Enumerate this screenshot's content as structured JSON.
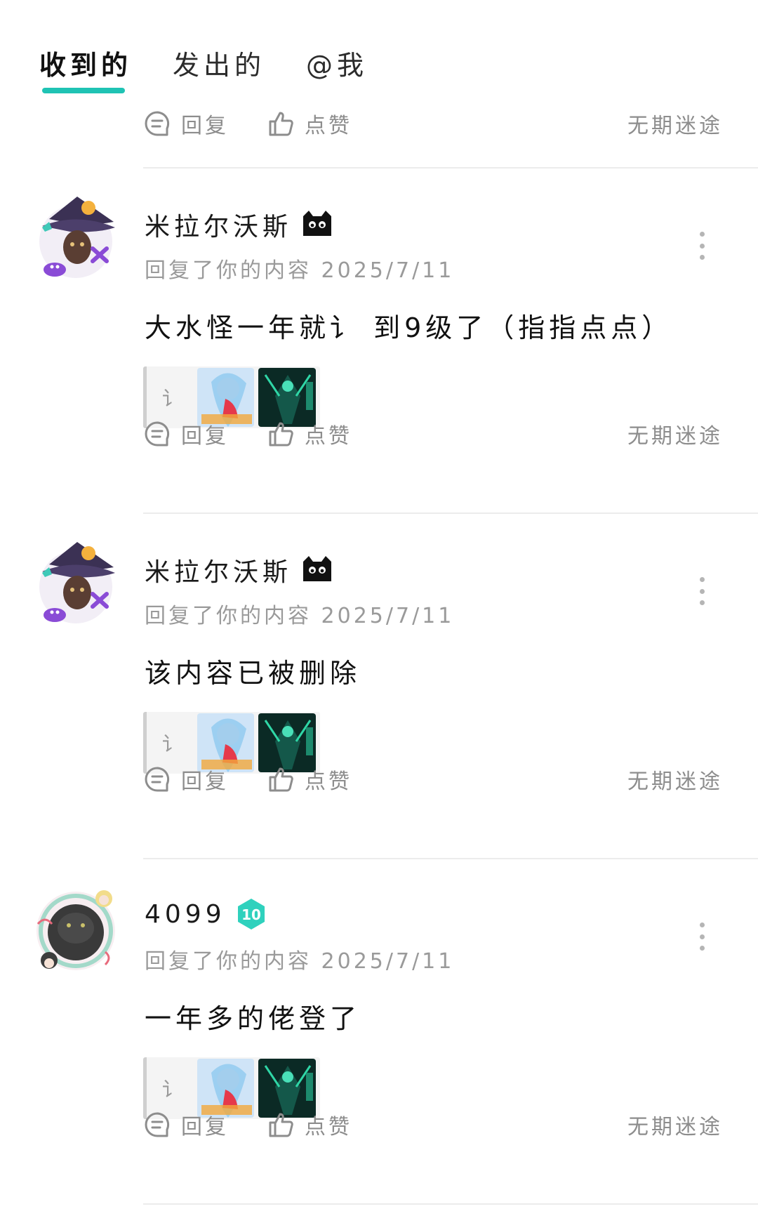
{
  "tabs": [
    {
      "label": "收到的",
      "active": true
    },
    {
      "label": "发出的",
      "active": false
    },
    {
      "label": "@我",
      "active": false
    }
  ],
  "actions": {
    "reply": "回复",
    "like": "点赞",
    "owner": "无期迷途"
  },
  "items": [
    {
      "username": "米拉尔沃斯",
      "meta": "回复了你的内容 2025/7/11",
      "content": "大水怪一年就讠 到9级了（指指点点）",
      "ref_text": "讠"
    },
    {
      "username": "米拉尔沃斯",
      "meta": "回复了你的内容 2025/7/11",
      "content": "该内容已被删除",
      "ref_text": "讠"
    },
    {
      "username": "4099",
      "level": "10",
      "meta": "回复了你的内容 2025/7/11",
      "content": "一年多的佬登了",
      "ref_text": "讠"
    }
  ],
  "colors": {
    "accent": "#1fc3b4",
    "muted": "#8d8d8d"
  }
}
